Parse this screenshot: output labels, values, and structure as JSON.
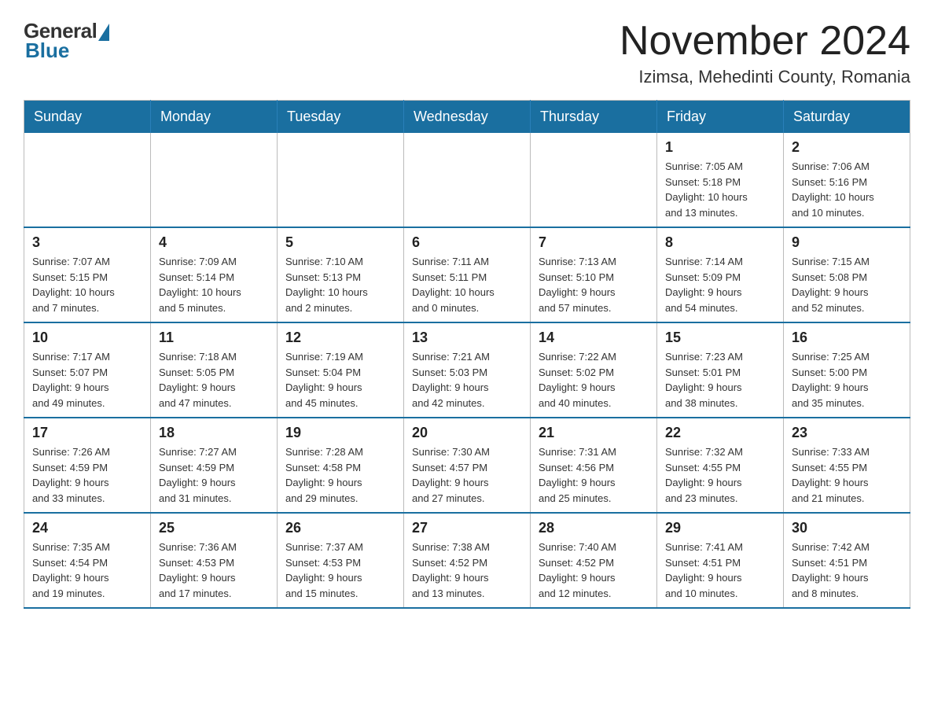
{
  "header": {
    "logo": {
      "general": "General",
      "blue": "Blue"
    },
    "month": "November 2024",
    "location": "Izimsa, Mehedinti County, Romania"
  },
  "weekdays": [
    "Sunday",
    "Monday",
    "Tuesday",
    "Wednesday",
    "Thursday",
    "Friday",
    "Saturday"
  ],
  "weeks": [
    [
      {
        "day": "",
        "info": ""
      },
      {
        "day": "",
        "info": ""
      },
      {
        "day": "",
        "info": ""
      },
      {
        "day": "",
        "info": ""
      },
      {
        "day": "",
        "info": ""
      },
      {
        "day": "1",
        "info": "Sunrise: 7:05 AM\nSunset: 5:18 PM\nDaylight: 10 hours\nand 13 minutes."
      },
      {
        "day": "2",
        "info": "Sunrise: 7:06 AM\nSunset: 5:16 PM\nDaylight: 10 hours\nand 10 minutes."
      }
    ],
    [
      {
        "day": "3",
        "info": "Sunrise: 7:07 AM\nSunset: 5:15 PM\nDaylight: 10 hours\nand 7 minutes."
      },
      {
        "day": "4",
        "info": "Sunrise: 7:09 AM\nSunset: 5:14 PM\nDaylight: 10 hours\nand 5 minutes."
      },
      {
        "day": "5",
        "info": "Sunrise: 7:10 AM\nSunset: 5:13 PM\nDaylight: 10 hours\nand 2 minutes."
      },
      {
        "day": "6",
        "info": "Sunrise: 7:11 AM\nSunset: 5:11 PM\nDaylight: 10 hours\nand 0 minutes."
      },
      {
        "day": "7",
        "info": "Sunrise: 7:13 AM\nSunset: 5:10 PM\nDaylight: 9 hours\nand 57 minutes."
      },
      {
        "day": "8",
        "info": "Sunrise: 7:14 AM\nSunset: 5:09 PM\nDaylight: 9 hours\nand 54 minutes."
      },
      {
        "day": "9",
        "info": "Sunrise: 7:15 AM\nSunset: 5:08 PM\nDaylight: 9 hours\nand 52 minutes."
      }
    ],
    [
      {
        "day": "10",
        "info": "Sunrise: 7:17 AM\nSunset: 5:07 PM\nDaylight: 9 hours\nand 49 minutes."
      },
      {
        "day": "11",
        "info": "Sunrise: 7:18 AM\nSunset: 5:05 PM\nDaylight: 9 hours\nand 47 minutes."
      },
      {
        "day": "12",
        "info": "Sunrise: 7:19 AM\nSunset: 5:04 PM\nDaylight: 9 hours\nand 45 minutes."
      },
      {
        "day": "13",
        "info": "Sunrise: 7:21 AM\nSunset: 5:03 PM\nDaylight: 9 hours\nand 42 minutes."
      },
      {
        "day": "14",
        "info": "Sunrise: 7:22 AM\nSunset: 5:02 PM\nDaylight: 9 hours\nand 40 minutes."
      },
      {
        "day": "15",
        "info": "Sunrise: 7:23 AM\nSunset: 5:01 PM\nDaylight: 9 hours\nand 38 minutes."
      },
      {
        "day": "16",
        "info": "Sunrise: 7:25 AM\nSunset: 5:00 PM\nDaylight: 9 hours\nand 35 minutes."
      }
    ],
    [
      {
        "day": "17",
        "info": "Sunrise: 7:26 AM\nSunset: 4:59 PM\nDaylight: 9 hours\nand 33 minutes."
      },
      {
        "day": "18",
        "info": "Sunrise: 7:27 AM\nSunset: 4:59 PM\nDaylight: 9 hours\nand 31 minutes."
      },
      {
        "day": "19",
        "info": "Sunrise: 7:28 AM\nSunset: 4:58 PM\nDaylight: 9 hours\nand 29 minutes."
      },
      {
        "day": "20",
        "info": "Sunrise: 7:30 AM\nSunset: 4:57 PM\nDaylight: 9 hours\nand 27 minutes."
      },
      {
        "day": "21",
        "info": "Sunrise: 7:31 AM\nSunset: 4:56 PM\nDaylight: 9 hours\nand 25 minutes."
      },
      {
        "day": "22",
        "info": "Sunrise: 7:32 AM\nSunset: 4:55 PM\nDaylight: 9 hours\nand 23 minutes."
      },
      {
        "day": "23",
        "info": "Sunrise: 7:33 AM\nSunset: 4:55 PM\nDaylight: 9 hours\nand 21 minutes."
      }
    ],
    [
      {
        "day": "24",
        "info": "Sunrise: 7:35 AM\nSunset: 4:54 PM\nDaylight: 9 hours\nand 19 minutes."
      },
      {
        "day": "25",
        "info": "Sunrise: 7:36 AM\nSunset: 4:53 PM\nDaylight: 9 hours\nand 17 minutes."
      },
      {
        "day": "26",
        "info": "Sunrise: 7:37 AM\nSunset: 4:53 PM\nDaylight: 9 hours\nand 15 minutes."
      },
      {
        "day": "27",
        "info": "Sunrise: 7:38 AM\nSunset: 4:52 PM\nDaylight: 9 hours\nand 13 minutes."
      },
      {
        "day": "28",
        "info": "Sunrise: 7:40 AM\nSunset: 4:52 PM\nDaylight: 9 hours\nand 12 minutes."
      },
      {
        "day": "29",
        "info": "Sunrise: 7:41 AM\nSunset: 4:51 PM\nDaylight: 9 hours\nand 10 minutes."
      },
      {
        "day": "30",
        "info": "Sunrise: 7:42 AM\nSunset: 4:51 PM\nDaylight: 9 hours\nand 8 minutes."
      }
    ]
  ]
}
